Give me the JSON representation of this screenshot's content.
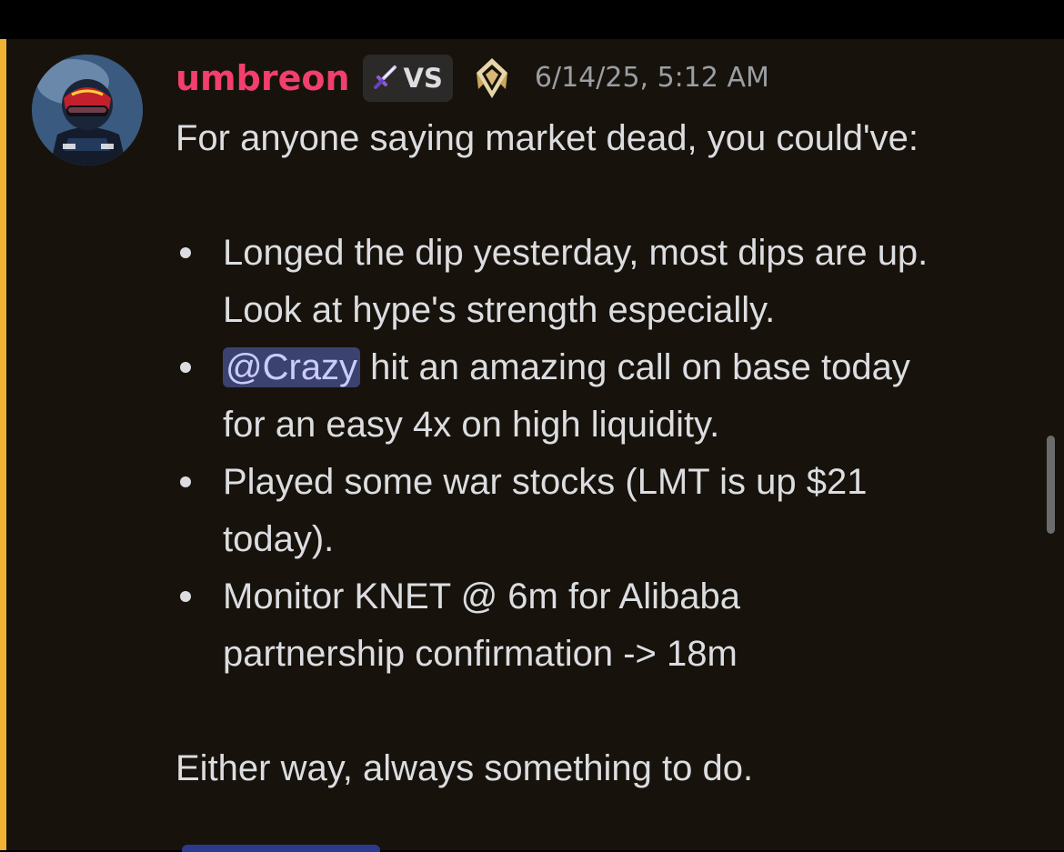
{
  "message": {
    "author": {
      "username": "umbreon",
      "username_color": "#f23f6d",
      "avatar_icon": "racing-driver-avatar",
      "tag": {
        "icon": "sword-icon",
        "label": "VS"
      },
      "badge_icon": "valorant-rank-badge-icon"
    },
    "timestamp": "6/14/25, 5:12 AM",
    "highlight_color": "#f0b232",
    "intro": "For anyone saying market dead, you could've:",
    "bullets": [
      {
        "line1": "Longed the dip yesterday, most dips are up.",
        "line2": "Look at hype's strength especially."
      },
      {
        "mention": "@Crazy",
        "line1_rest": " hit an amazing call on base today",
        "line2": "for an easy 4x on high liquidity."
      },
      {
        "line1": "Played some war stocks (LMT is up $21",
        "line2": "today)."
      },
      {
        "line1": "Monitor KNET @ 6m for Alibaba",
        "line2": "partnership confirmation -> 18m"
      }
    ],
    "outro": "Either way, always something to do."
  }
}
